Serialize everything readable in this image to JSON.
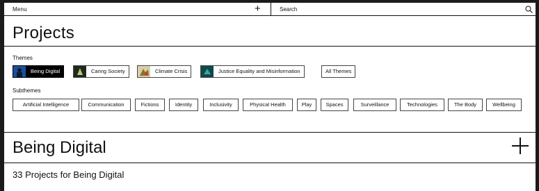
{
  "topbar": {
    "menu_label": "Menu",
    "search_label": "Search"
  },
  "page_title": "Projects",
  "themes": {
    "label": "Themes",
    "items": [
      {
        "label": "Being Digital",
        "active": true
      },
      {
        "label": "Caring Society",
        "active": false
      },
      {
        "label": "Climate Crisis",
        "active": false
      },
      {
        "label": "Justice Equality and Misinformation",
        "active": false
      },
      {
        "label": "All Themes",
        "active": false
      }
    ]
  },
  "subthemes": {
    "label": "Subthemes",
    "items": [
      "Artificial Intelligence",
      "Communication",
      "Fictions",
      "Identity",
      "Inclusivity",
      "Physical Health",
      "Play",
      "Spaces",
      "Surveillance",
      "Technologies",
      "The Body",
      "Wellbeing"
    ]
  },
  "section": {
    "title": "Being Digital",
    "count_text": "33 Projects for Being Digital"
  }
}
